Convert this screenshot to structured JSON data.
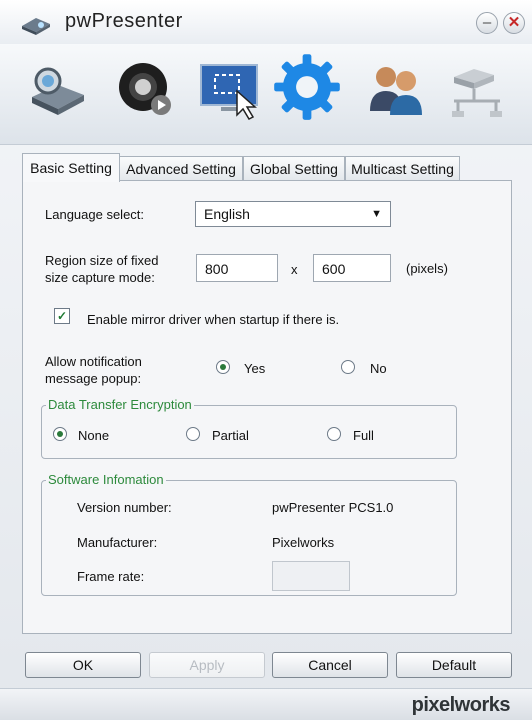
{
  "window": {
    "title": "pwPresenter",
    "minimize_label": "–",
    "close_label": "✕"
  },
  "toolbar": {
    "items": [
      {
        "name": "projector-icon"
      },
      {
        "name": "camera-icon"
      },
      {
        "name": "screen-capture-icon"
      },
      {
        "name": "settings-gear-icon"
      },
      {
        "name": "users-icon"
      },
      {
        "name": "network-icon"
      }
    ]
  },
  "tabs": [
    "Basic Setting",
    "Advanced Setting",
    "Global Setting",
    "Multicast Setting"
  ],
  "basic": {
    "language_label": "Language select:",
    "language_value": "English",
    "region_label_line1": "Region size of fixed",
    "region_label_line2": "size capture mode:",
    "width_value": "800",
    "times": "x",
    "height_value": "600",
    "unit": "(pixels)",
    "mirror_label": "Enable mirror driver when startup if there is.",
    "mirror_checked": true,
    "notify_label_line1": "Allow notification",
    "notify_label_line2": "message popup:",
    "notify_yes": "Yes",
    "notify_no": "No",
    "notify_selected": "Yes"
  },
  "encryption": {
    "legend": "Data Transfer Encryption",
    "options": [
      "None",
      "Partial",
      "Full"
    ],
    "selected": "None"
  },
  "software": {
    "legend": "Software Infomation",
    "version_label": "Version number:",
    "version_value": "pwPresenter PCS1.0",
    "manufacturer_label": "Manufacturer:",
    "manufacturer_value": "Pixelworks",
    "framerate_label": "Frame rate:",
    "framerate_value": ""
  },
  "buttons": {
    "ok": "OK",
    "apply": "Apply",
    "cancel": "Cancel",
    "default": "Default"
  },
  "brand": "pixelworks",
  "colors": {
    "accent_green": "#2d8a3c",
    "gear_blue": "#1e88e5"
  }
}
